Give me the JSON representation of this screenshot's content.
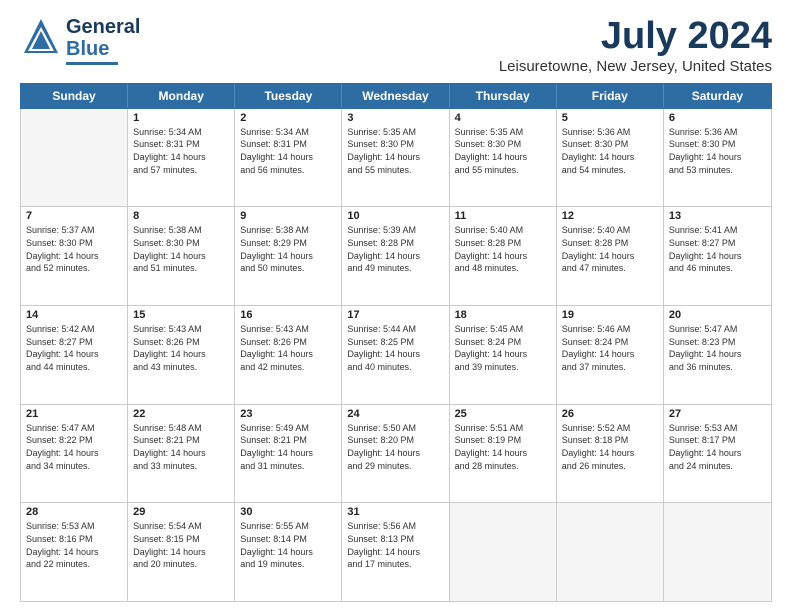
{
  "logo": {
    "line1": "General",
    "line2": "Blue"
  },
  "title": "July 2024",
  "subtitle": "Leisuretowne, New Jersey, United States",
  "days": [
    "Sunday",
    "Monday",
    "Tuesday",
    "Wednesday",
    "Thursday",
    "Friday",
    "Saturday"
  ],
  "weeks": [
    [
      {
        "day": "",
        "empty": true
      },
      {
        "day": "1",
        "sunrise": "5:34 AM",
        "sunset": "8:31 PM",
        "daylight": "14 hours and 57 minutes."
      },
      {
        "day": "2",
        "sunrise": "5:34 AM",
        "sunset": "8:31 PM",
        "daylight": "14 hours and 56 minutes."
      },
      {
        "day": "3",
        "sunrise": "5:35 AM",
        "sunset": "8:30 PM",
        "daylight": "14 hours and 55 minutes."
      },
      {
        "day": "4",
        "sunrise": "5:35 AM",
        "sunset": "8:30 PM",
        "daylight": "14 hours and 55 minutes."
      },
      {
        "day": "5",
        "sunrise": "5:36 AM",
        "sunset": "8:30 PM",
        "daylight": "14 hours and 54 minutes."
      },
      {
        "day": "6",
        "sunrise": "5:36 AM",
        "sunset": "8:30 PM",
        "daylight": "14 hours and 53 minutes."
      }
    ],
    [
      {
        "day": "7",
        "sunrise": "5:37 AM",
        "sunset": "8:30 PM",
        "daylight": "14 hours and 52 minutes."
      },
      {
        "day": "8",
        "sunrise": "5:38 AM",
        "sunset": "8:30 PM",
        "daylight": "14 hours and 51 minutes."
      },
      {
        "day": "9",
        "sunrise": "5:38 AM",
        "sunset": "8:29 PM",
        "daylight": "14 hours and 50 minutes."
      },
      {
        "day": "10",
        "sunrise": "5:39 AM",
        "sunset": "8:28 PM",
        "daylight": "14 hours and 49 minutes."
      },
      {
        "day": "11",
        "sunrise": "5:40 AM",
        "sunset": "8:28 PM",
        "daylight": "14 hours and 48 minutes."
      },
      {
        "day": "12",
        "sunrise": "5:40 AM",
        "sunset": "8:28 PM",
        "daylight": "14 hours and 47 minutes."
      },
      {
        "day": "13",
        "sunrise": "5:41 AM",
        "sunset": "8:27 PM",
        "daylight": "14 hours and 46 minutes."
      }
    ],
    [
      {
        "day": "14",
        "sunrise": "5:42 AM",
        "sunset": "8:27 PM",
        "daylight": "14 hours and 44 minutes."
      },
      {
        "day": "15",
        "sunrise": "5:43 AM",
        "sunset": "8:26 PM",
        "daylight": "14 hours and 43 minutes."
      },
      {
        "day": "16",
        "sunrise": "5:43 AM",
        "sunset": "8:26 PM",
        "daylight": "14 hours and 42 minutes."
      },
      {
        "day": "17",
        "sunrise": "5:44 AM",
        "sunset": "8:25 PM",
        "daylight": "14 hours and 40 minutes."
      },
      {
        "day": "18",
        "sunrise": "5:45 AM",
        "sunset": "8:24 PM",
        "daylight": "14 hours and 39 minutes."
      },
      {
        "day": "19",
        "sunrise": "5:46 AM",
        "sunset": "8:24 PM",
        "daylight": "14 hours and 37 minutes."
      },
      {
        "day": "20",
        "sunrise": "5:47 AM",
        "sunset": "8:23 PM",
        "daylight": "14 hours and 36 minutes."
      }
    ],
    [
      {
        "day": "21",
        "sunrise": "5:47 AM",
        "sunset": "8:22 PM",
        "daylight": "14 hours and 34 minutes."
      },
      {
        "day": "22",
        "sunrise": "5:48 AM",
        "sunset": "8:21 PM",
        "daylight": "14 hours and 33 minutes."
      },
      {
        "day": "23",
        "sunrise": "5:49 AM",
        "sunset": "8:21 PM",
        "daylight": "14 hours and 31 minutes."
      },
      {
        "day": "24",
        "sunrise": "5:50 AM",
        "sunset": "8:20 PM",
        "daylight": "14 hours and 29 minutes."
      },
      {
        "day": "25",
        "sunrise": "5:51 AM",
        "sunset": "8:19 PM",
        "daylight": "14 hours and 28 minutes."
      },
      {
        "day": "26",
        "sunrise": "5:52 AM",
        "sunset": "8:18 PM",
        "daylight": "14 hours and 26 minutes."
      },
      {
        "day": "27",
        "sunrise": "5:53 AM",
        "sunset": "8:17 PM",
        "daylight": "14 hours and 24 minutes."
      }
    ],
    [
      {
        "day": "28",
        "sunrise": "5:53 AM",
        "sunset": "8:16 PM",
        "daylight": "14 hours and 22 minutes."
      },
      {
        "day": "29",
        "sunrise": "5:54 AM",
        "sunset": "8:15 PM",
        "daylight": "14 hours and 20 minutes."
      },
      {
        "day": "30",
        "sunrise": "5:55 AM",
        "sunset": "8:14 PM",
        "daylight": "14 hours and 19 minutes."
      },
      {
        "day": "31",
        "sunrise": "5:56 AM",
        "sunset": "8:13 PM",
        "daylight": "14 hours and 17 minutes."
      },
      {
        "day": "",
        "empty": true
      },
      {
        "day": "",
        "empty": true
      },
      {
        "day": "",
        "empty": true
      }
    ]
  ]
}
